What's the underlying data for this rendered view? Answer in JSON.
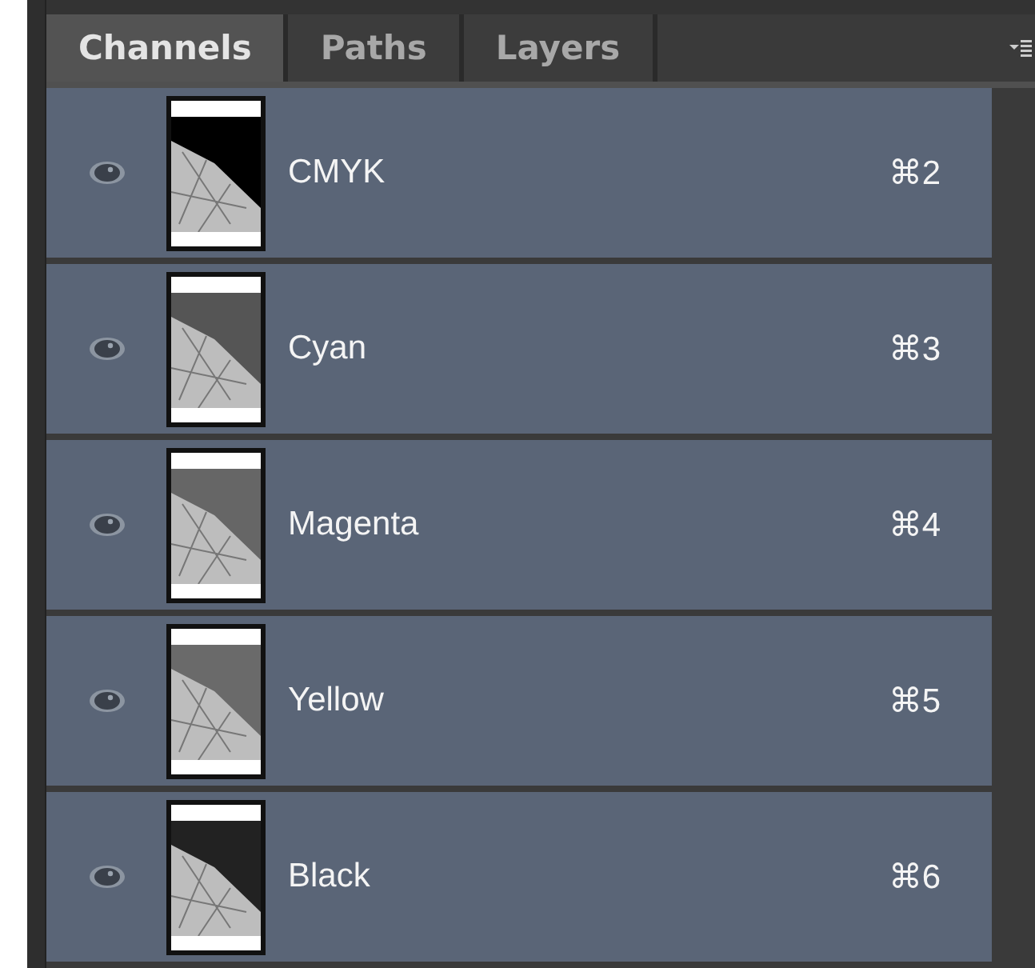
{
  "tabs": [
    {
      "label": "Channels",
      "selected": true
    },
    {
      "label": "Paths",
      "selected": false
    },
    {
      "label": "Layers",
      "selected": false
    }
  ],
  "channels": [
    {
      "name": "CMYK",
      "shortcut": "⌘2",
      "visible": true,
      "selected": true,
      "color": "#000000"
    },
    {
      "name": "Cyan",
      "shortcut": "⌘3",
      "visible": true,
      "selected": true,
      "color": "#555555"
    },
    {
      "name": "Magenta",
      "shortcut": "⌘4",
      "visible": true,
      "selected": true,
      "color": "#666666"
    },
    {
      "name": "Yellow",
      "shortcut": "⌘5",
      "visible": true,
      "selected": true,
      "color": "#6a6a6a"
    },
    {
      "name": "Black",
      "shortcut": "⌘6",
      "visible": true,
      "selected": true,
      "color": "#222222"
    }
  ]
}
